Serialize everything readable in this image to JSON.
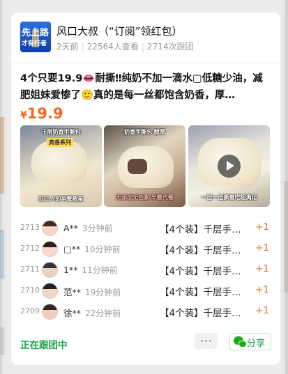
{
  "group": {
    "title": "风口大叔（“订阅”领红包）",
    "avatar_text_line1": "先上路",
    "avatar_text_line2": "才有行者",
    "posted": "2天前",
    "views": "22564人查看",
    "joins": "2714次跟团"
  },
  "post": {
    "description": "4个只要19.9👄耐撕‼纯奶不加一滴水▢低糖少油，减肥姐妹爱惨了🙂真的是每一丝都饱含奶香，厚…",
    "price_symbol": "¥",
    "price_value": "19.9"
  },
  "photos": [
    {
      "caption_top": "千层奶香手撕包",
      "tag": "真香系列",
      "caption_bottom": "打工人的早餐救星"
    },
    {
      "caption_top": "奶香手撕包 醇厚",
      "caption_bottom": "无添加无色素 早餐代餐"
    },
    {
      "caption_bottom": "一层一层撕着吃超满足",
      "has_video": true
    }
  ],
  "buyers": [
    {
      "num": "2713",
      "name": "A**",
      "time": "3分钟前",
      "item": "【4个装】千层手…",
      "qty": "+1"
    },
    {
      "num": "2712",
      "name": "▢**",
      "time": "10分钟前",
      "item": "【4个装】千层手…",
      "qty": "+1"
    },
    {
      "num": "2711",
      "name": "1**",
      "time": "11分钟前",
      "item": "【4个装】千层手…",
      "qty": "+1"
    },
    {
      "num": "2710",
      "name": "范**",
      "time": "19分钟前",
      "item": "【4个装】千层手…",
      "qty": "+1"
    },
    {
      "num": "2709",
      "name": "徐**",
      "time": "22分钟前",
      "item": "【4个装】千层手…",
      "qty": "+1"
    }
  ],
  "footer": {
    "status": "正在跟团中",
    "share_label": "分享",
    "share_icon": "wechat-icon",
    "more_icon": "more-dots-icon"
  },
  "colors": {
    "accent_orange": "#f2691c",
    "accent_green": "#1aa34a"
  }
}
